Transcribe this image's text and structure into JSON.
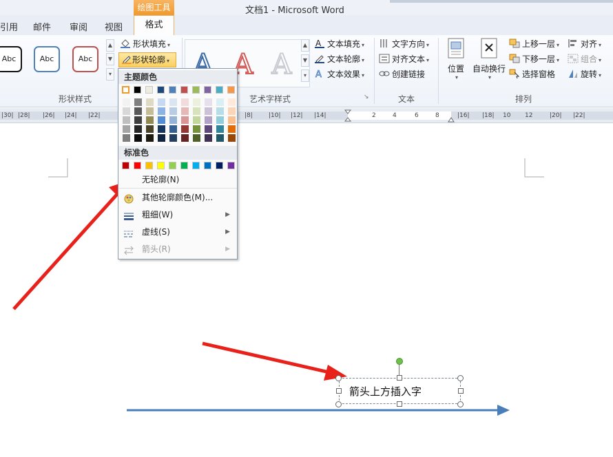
{
  "window": {
    "title": "文档1  -  Microsoft Word",
    "contextual_tab": "绘图工具"
  },
  "tabs": {
    "references": "引用",
    "mailings": "邮件",
    "review": "审阅",
    "view": "视图",
    "format": "格式"
  },
  "ribbon": {
    "shape_styles": {
      "label": "形状样式",
      "sample_text": "Abc",
      "shape_fill": "形状填充",
      "shape_outline": "形状轮廓"
    },
    "wordart_styles": {
      "label": "艺术字样式",
      "text_fill": "文本填充",
      "text_outline": "文本轮廓",
      "text_effects": "文本效果",
      "sample": "A"
    },
    "text": {
      "label": "文本",
      "text_direction": "文字方向",
      "align_text": "对齐文本",
      "create_link": "创建链接"
    },
    "arrange": {
      "label": "排列",
      "position": "位置",
      "wrap_text": "自动换行",
      "bring_forward": "上移一层",
      "send_backward": "下移一层",
      "selection_pane": "选择窗格",
      "align": "对齐",
      "group": "组合",
      "rotate": "旋转"
    }
  },
  "ruler": {
    "left_numbers": [
      "|30|",
      "|28|",
      "|26|",
      "|24|",
      "|22|"
    ],
    "right_numbers": [
      "|8|",
      "|10|",
      "|12|",
      "|14|",
      "|16|",
      "|18|",
      "|20|",
      "|22|"
    ],
    "inner_numbers": [
      "2",
      "4",
      "6",
      "8",
      "10",
      "12"
    ]
  },
  "menu": {
    "theme_colors_label": "主题颜色",
    "standard_colors_label": "标准色",
    "theme_colors": [
      "#ffffff",
      "#000000",
      "#eeece1",
      "#1f497d",
      "#4f81bd",
      "#c0504d",
      "#9bbb59",
      "#8064a2",
      "#4bacc6",
      "#f79646"
    ],
    "theme_shades": [
      [
        "#f2f2f2",
        "#d8d8d8",
        "#bfbfbf",
        "#a5a5a5",
        "#7f7f7f"
      ],
      [
        "#7f7f7f",
        "#595959",
        "#3f3f3f",
        "#262626",
        "#0c0c0c"
      ],
      [
        "#ddd9c3",
        "#c4bd97",
        "#938953",
        "#494429",
        "#1d1b10"
      ],
      [
        "#c6d9f0",
        "#8db3e2",
        "#548dd4",
        "#17365d",
        "#0f243e"
      ],
      [
        "#dbe5f1",
        "#b8cce4",
        "#95b3d7",
        "#366092",
        "#244061"
      ],
      [
        "#f2dcdb",
        "#e5b9b7",
        "#d99694",
        "#953734",
        "#632423"
      ],
      [
        "#ebf1dd",
        "#d7e3bc",
        "#c3d69b",
        "#76923c",
        "#4f6128"
      ],
      [
        "#e5e0ec",
        "#ccc1d9",
        "#b2a2c7",
        "#5f497a",
        "#3f3151"
      ],
      [
        "#dbeef3",
        "#b7dde8",
        "#92cddc",
        "#31859b",
        "#205867"
      ],
      [
        "#fdeada",
        "#fbd5b5",
        "#fac08f",
        "#e36c09",
        "#974806"
      ]
    ],
    "standard_colors": [
      "#c00000",
      "#ff0000",
      "#ffc000",
      "#ffff00",
      "#92d050",
      "#00b050",
      "#00b0f0",
      "#0070c0",
      "#002060",
      "#7030a0"
    ],
    "no_outline": "无轮廓(N)",
    "more_colors": "其他轮廓颜色(M)...",
    "weight": "粗细(W)",
    "dashes": "虚线(S)",
    "arrows": "箭头(R)"
  },
  "document": {
    "textbox_text": "箭头上方插入字"
  },
  "colors": {
    "annotation_arrow": "#e8211a",
    "connector_line": "#4a7ebb",
    "accent_orange": "#f09a2e"
  }
}
